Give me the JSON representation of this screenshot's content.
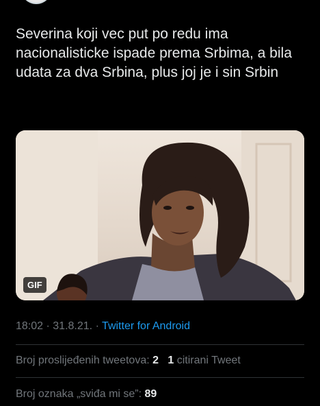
{
  "tweet": {
    "text": "Severina koji vec put po redu ima nacionalisticke ispade prema Srbima, a bila udata za dva Srbina, plus joj je i sin Srbin",
    "media": {
      "badge": "GIF"
    },
    "time": "18:02",
    "separator": "·",
    "date": "31.8.21.",
    "source": "Twitter for Android"
  },
  "stats": {
    "retweets_label": "Broj proslijeđenih tweetova:",
    "retweets_count": "2",
    "quotes_count": "1",
    "quotes_label": "citirani Tweet",
    "likes_label": "Broj oznaka „sviđa mi se”:",
    "likes_count": "89"
  },
  "colors": {
    "background": "#000000",
    "text": "#e7e9ea",
    "secondary": "#71767b",
    "link": "#1d9bf0",
    "divider": "#2f3336"
  }
}
